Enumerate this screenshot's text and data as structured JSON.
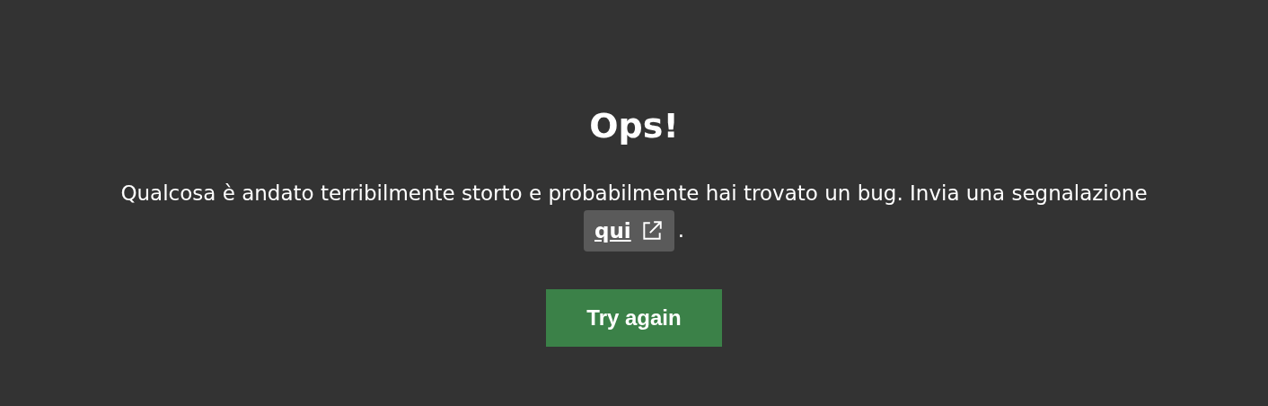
{
  "title": "Ops!",
  "message": {
    "text": "Qualcosa è andato terribilmente storto e probabilmente hai trovato un bug. Invia una segnalazione",
    "link": "qui",
    "after": "."
  },
  "button": "Try again"
}
